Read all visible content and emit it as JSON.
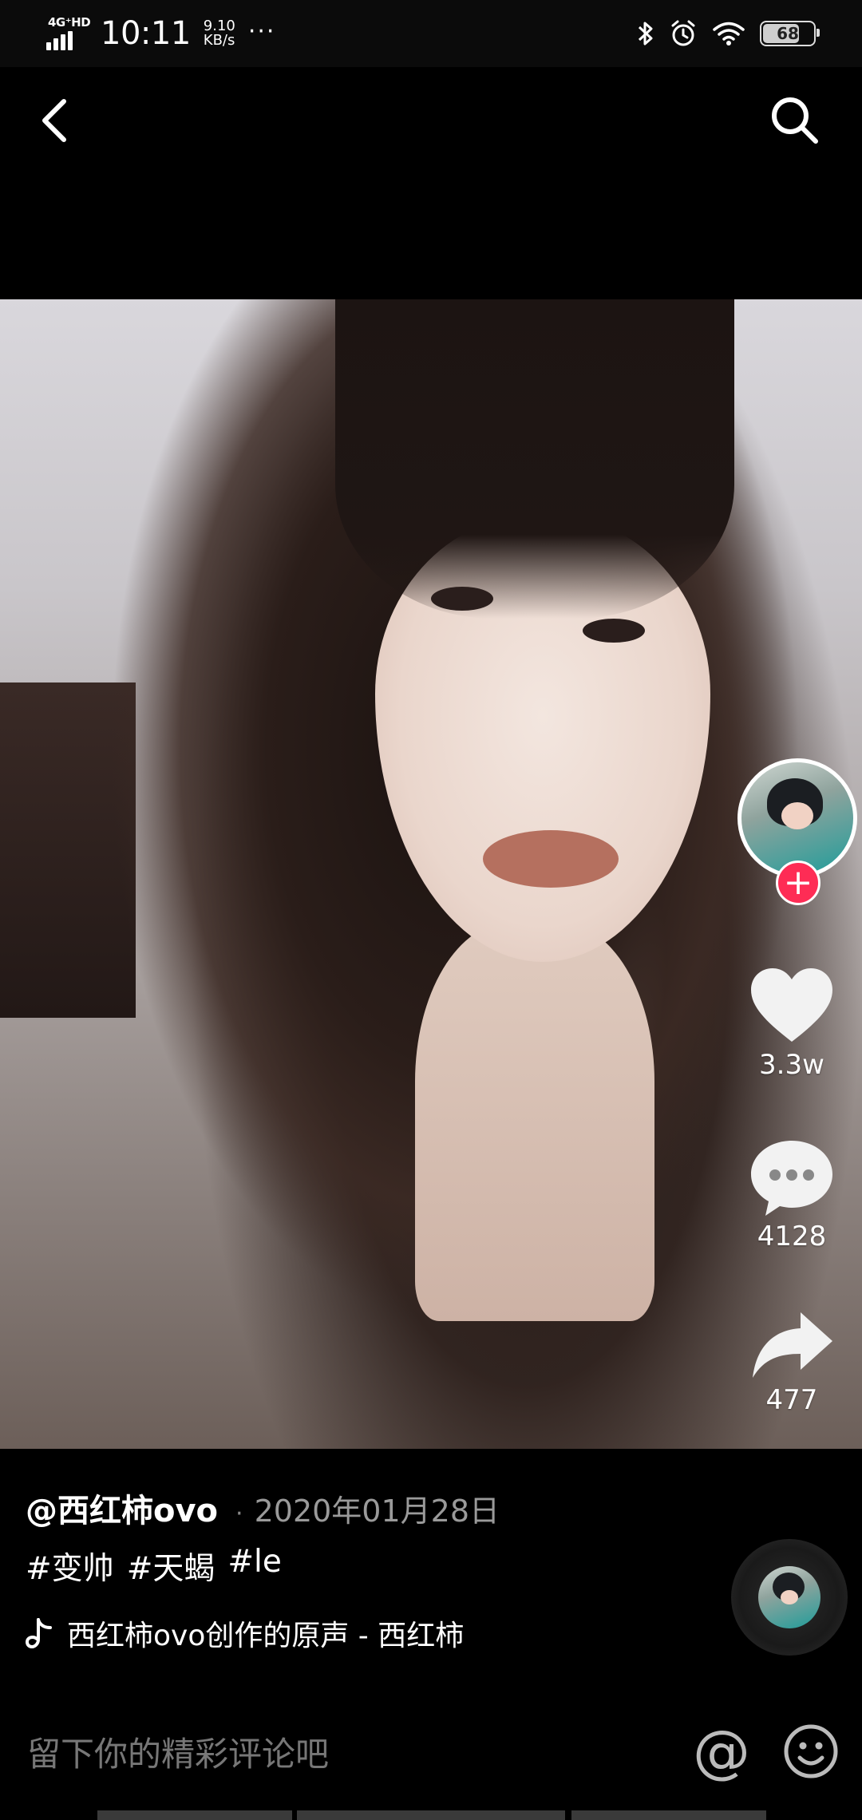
{
  "status_bar": {
    "network": "4G⁺HD",
    "time": "10:11",
    "speed_value": "9.10",
    "speed_unit": "KB/s",
    "more": "···",
    "battery": "68"
  },
  "post": {
    "author": "@西红柿ovo",
    "date": "2020年01月28日",
    "hashtags": [
      "#变帅",
      "#天蝎",
      "#le"
    ],
    "music": "西红柿ovo创作的原声 - 西红柿"
  },
  "actions": {
    "likes": "3.3w",
    "comments": "4128",
    "shares": "477",
    "follow": "+"
  },
  "comment_bar": {
    "placeholder": "留下你的精彩评论吧",
    "mention": "@"
  },
  "colors": {
    "accent": "#fe2c55",
    "background": "#000000"
  },
  "icons": [
    "back-icon",
    "search-icon",
    "heart-icon",
    "comment-icon",
    "share-icon",
    "music-note-icon",
    "emoji-icon"
  ]
}
